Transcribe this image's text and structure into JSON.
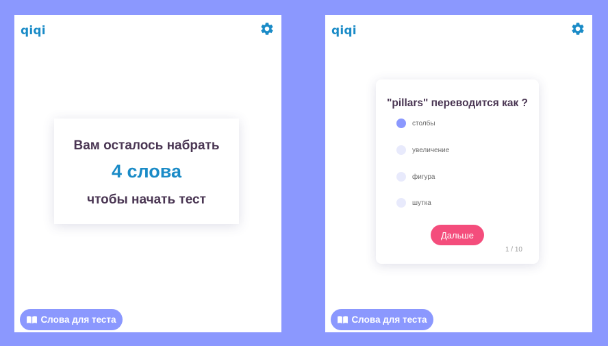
{
  "colors": {
    "background": "#8b98fe",
    "brand": "#1a8bc7",
    "heading": "#4a3653",
    "accent_button": "#f44d7c",
    "radio_idle": "#e8eafc",
    "radio_selected": "#8b98fe"
  },
  "left_panel": {
    "logo": "qiqi",
    "settings_icon": "gear-icon",
    "remaining": {
      "line1": "Вам осталось набрать",
      "count": "4 слова",
      "line2": "чтобы начать тест"
    },
    "words_button": {
      "icon": "book-icon",
      "label": "Слова для теста"
    }
  },
  "right_panel": {
    "logo": "qiqi",
    "settings_icon": "gear-icon",
    "quiz": {
      "question": "\"pillars\" переводится как ?",
      "options": [
        {
          "label": "столбы",
          "selected": true
        },
        {
          "label": "увеличение",
          "selected": false
        },
        {
          "label": "фигура",
          "selected": false
        },
        {
          "label": "шутка",
          "selected": false
        }
      ],
      "next_label": "Дальше",
      "progress": "1 / 10"
    },
    "words_button": {
      "icon": "book-icon",
      "label": "Слова для теста"
    }
  }
}
